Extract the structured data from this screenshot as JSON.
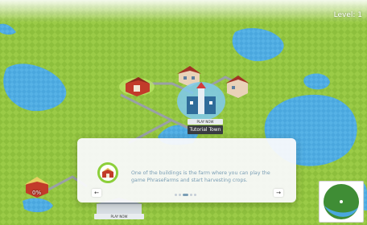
{
  "hud": {
    "level_label": "Level: 1"
  },
  "map": {
    "tutorial_town": {
      "play_label": "PLAY NOW",
      "name": "Tutorial Town"
    },
    "bottom_location": {
      "play_label": "PLAY NOW"
    },
    "farm_progress": "0%"
  },
  "dialog": {
    "text": "One of the buildings is the farm where you can play the game PhraseFarms and start harvesting crops.",
    "prev_label": "←",
    "next_label": "→",
    "total_pages": 5,
    "current_page": 3
  },
  "colors": {
    "grass": "#8dbf3c",
    "water": "#4aa7de",
    "road": "#9aa0a6",
    "dialog_text": "#7a9eb5",
    "icon_ring": "#8ccf3a"
  },
  "icons": [
    "barn-icon",
    "house-icon",
    "town-hall-icon",
    "farm-icon",
    "minimap-icon"
  ]
}
